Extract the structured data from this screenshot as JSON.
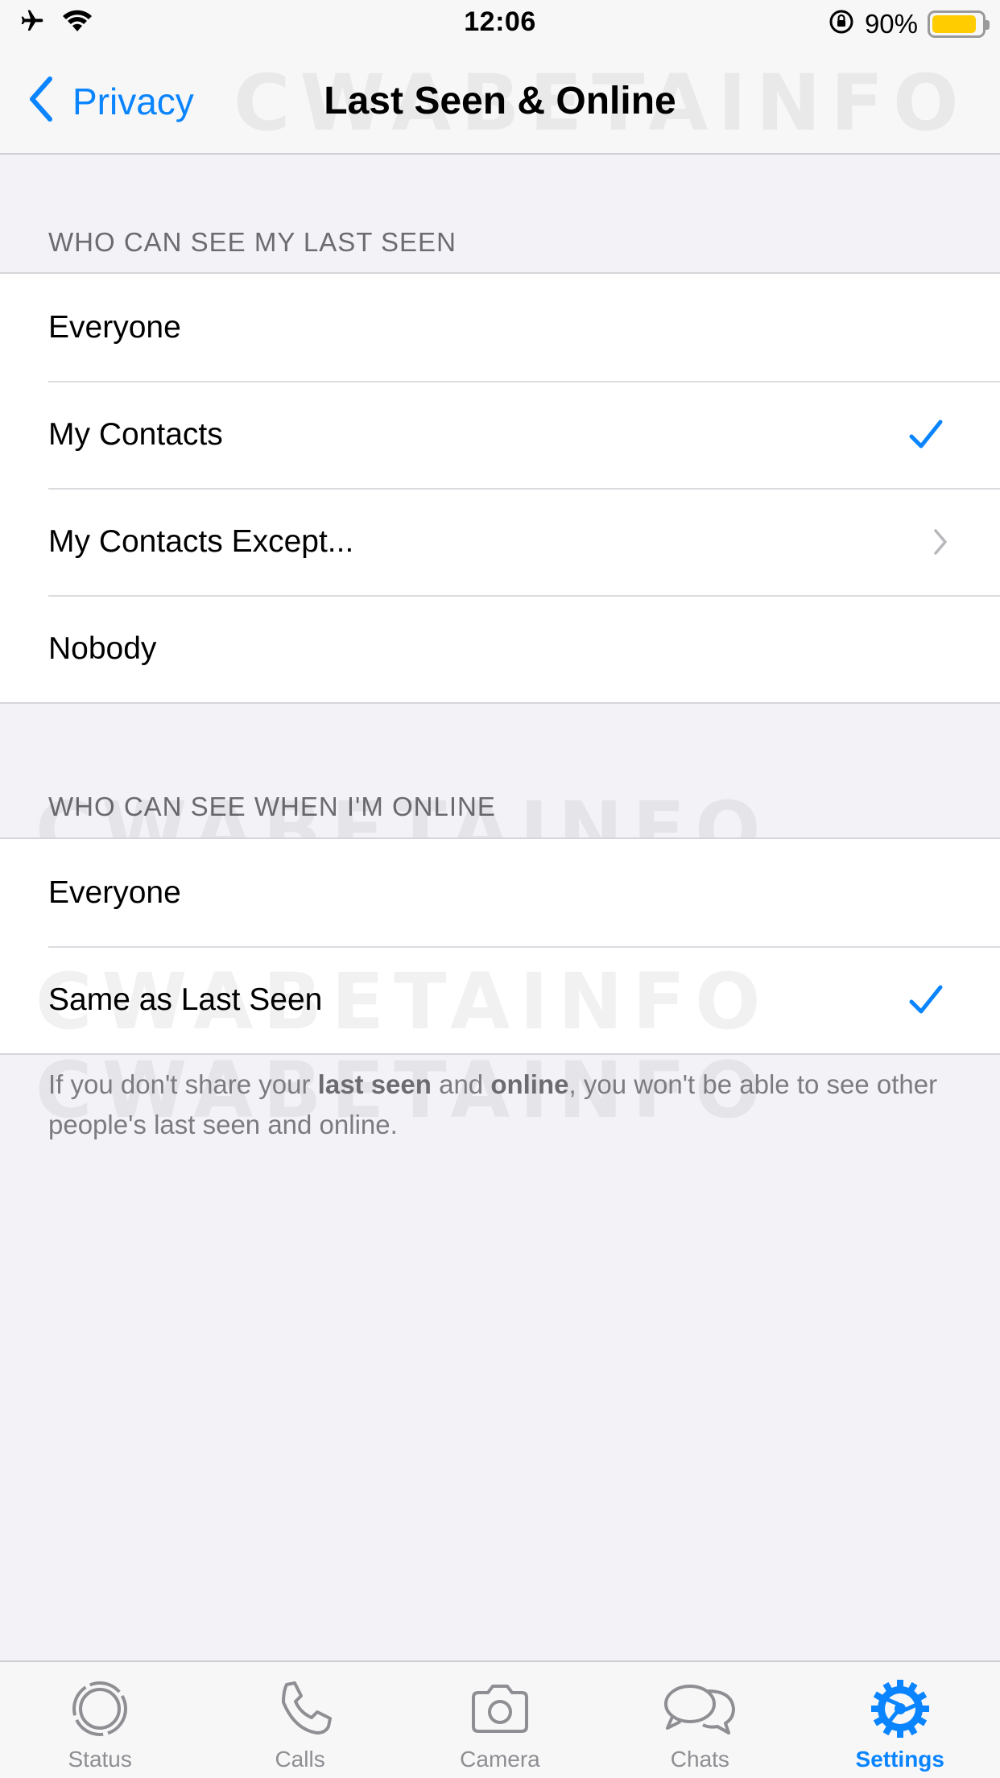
{
  "status_bar": {
    "time": "12:06",
    "battery_percent": "90%",
    "battery_level": 0.9,
    "battery_color": "#ffcc00",
    "icons": [
      "airplane-icon",
      "wifi-icon",
      "orientation-lock-icon",
      "battery-icon"
    ]
  },
  "nav": {
    "back_label": "Privacy",
    "title": "Last Seen & Online"
  },
  "watermark": "CWABETAINFO",
  "last_seen_section": {
    "header": "WHO CAN SEE MY LAST SEEN",
    "options": [
      {
        "label": "Everyone",
        "accessory": "none"
      },
      {
        "label": "My Contacts",
        "accessory": "checkmark"
      },
      {
        "label": "My Contacts Except...",
        "accessory": "chevron"
      },
      {
        "label": "Nobody",
        "accessory": "none"
      }
    ]
  },
  "online_section": {
    "header": "WHO CAN SEE WHEN I'M ONLINE",
    "options": [
      {
        "label": "Everyone",
        "accessory": "none"
      },
      {
        "label": "Same as Last Seen",
        "accessory": "checkmark"
      }
    ]
  },
  "footer": {
    "part1": "If you don't share your ",
    "bold1": "last seen",
    "part2": " and ",
    "bold2": "online",
    "part3": ", you won't be able to see other people's last seen and online."
  },
  "tabs": [
    {
      "label": "Status",
      "icon": "status-icon",
      "active": false
    },
    {
      "label": "Calls",
      "icon": "phone-icon",
      "active": false
    },
    {
      "label": "Camera",
      "icon": "camera-icon",
      "active": false
    },
    {
      "label": "Chats",
      "icon": "chats-icon",
      "active": false
    },
    {
      "label": "Settings",
      "icon": "gear-icon",
      "active": true
    }
  ],
  "colors": {
    "accent": "#0a84ff",
    "background": "#f2f2f7",
    "secondary_text": "#6c6c70"
  }
}
